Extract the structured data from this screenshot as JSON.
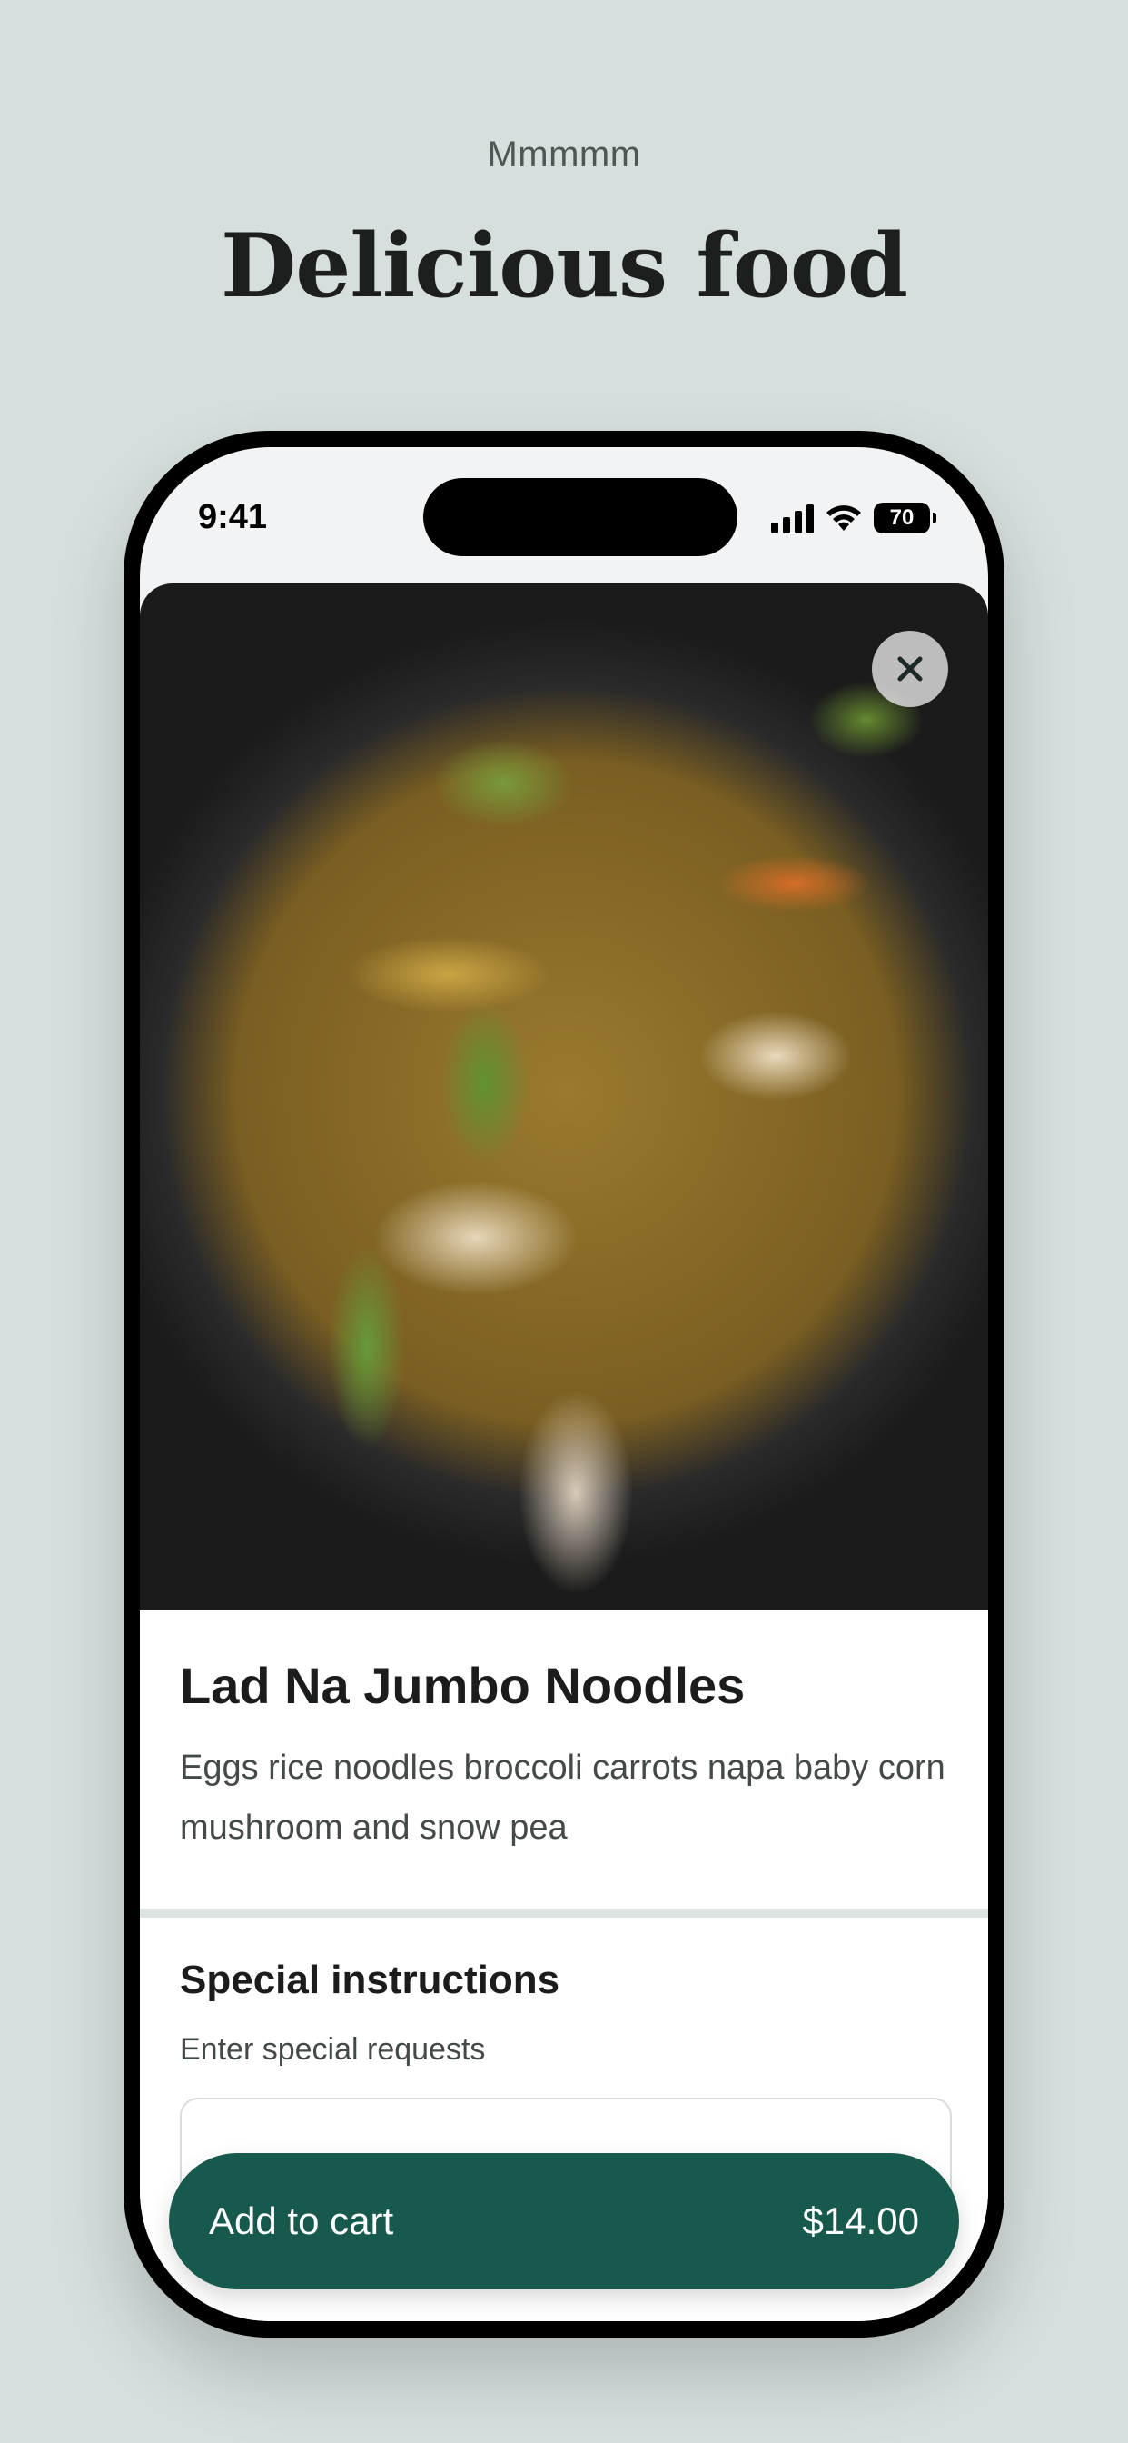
{
  "header": {
    "eyebrow": "Mmmmm",
    "headline": "Delicious food"
  },
  "status_bar": {
    "time": "9:41",
    "battery": "70",
    "icons": [
      "signal-icon",
      "wifi-icon",
      "battery-icon"
    ]
  },
  "item": {
    "photo_alt": "food-photo",
    "close_icon": "close-icon",
    "name": "Lad Na Jumbo Noodles",
    "description": "Eggs rice noodles broccoli carrots napa baby corn mushroom and snow pea"
  },
  "special_instructions": {
    "title": "Special instructions",
    "subtitle": "Enter special requests",
    "value": ""
  },
  "cart_button": {
    "label": "Add to cart",
    "price": "$14.00"
  },
  "colors": {
    "background": "#d6dfde",
    "accent": "#17594c",
    "text": "#1b1c1c"
  }
}
